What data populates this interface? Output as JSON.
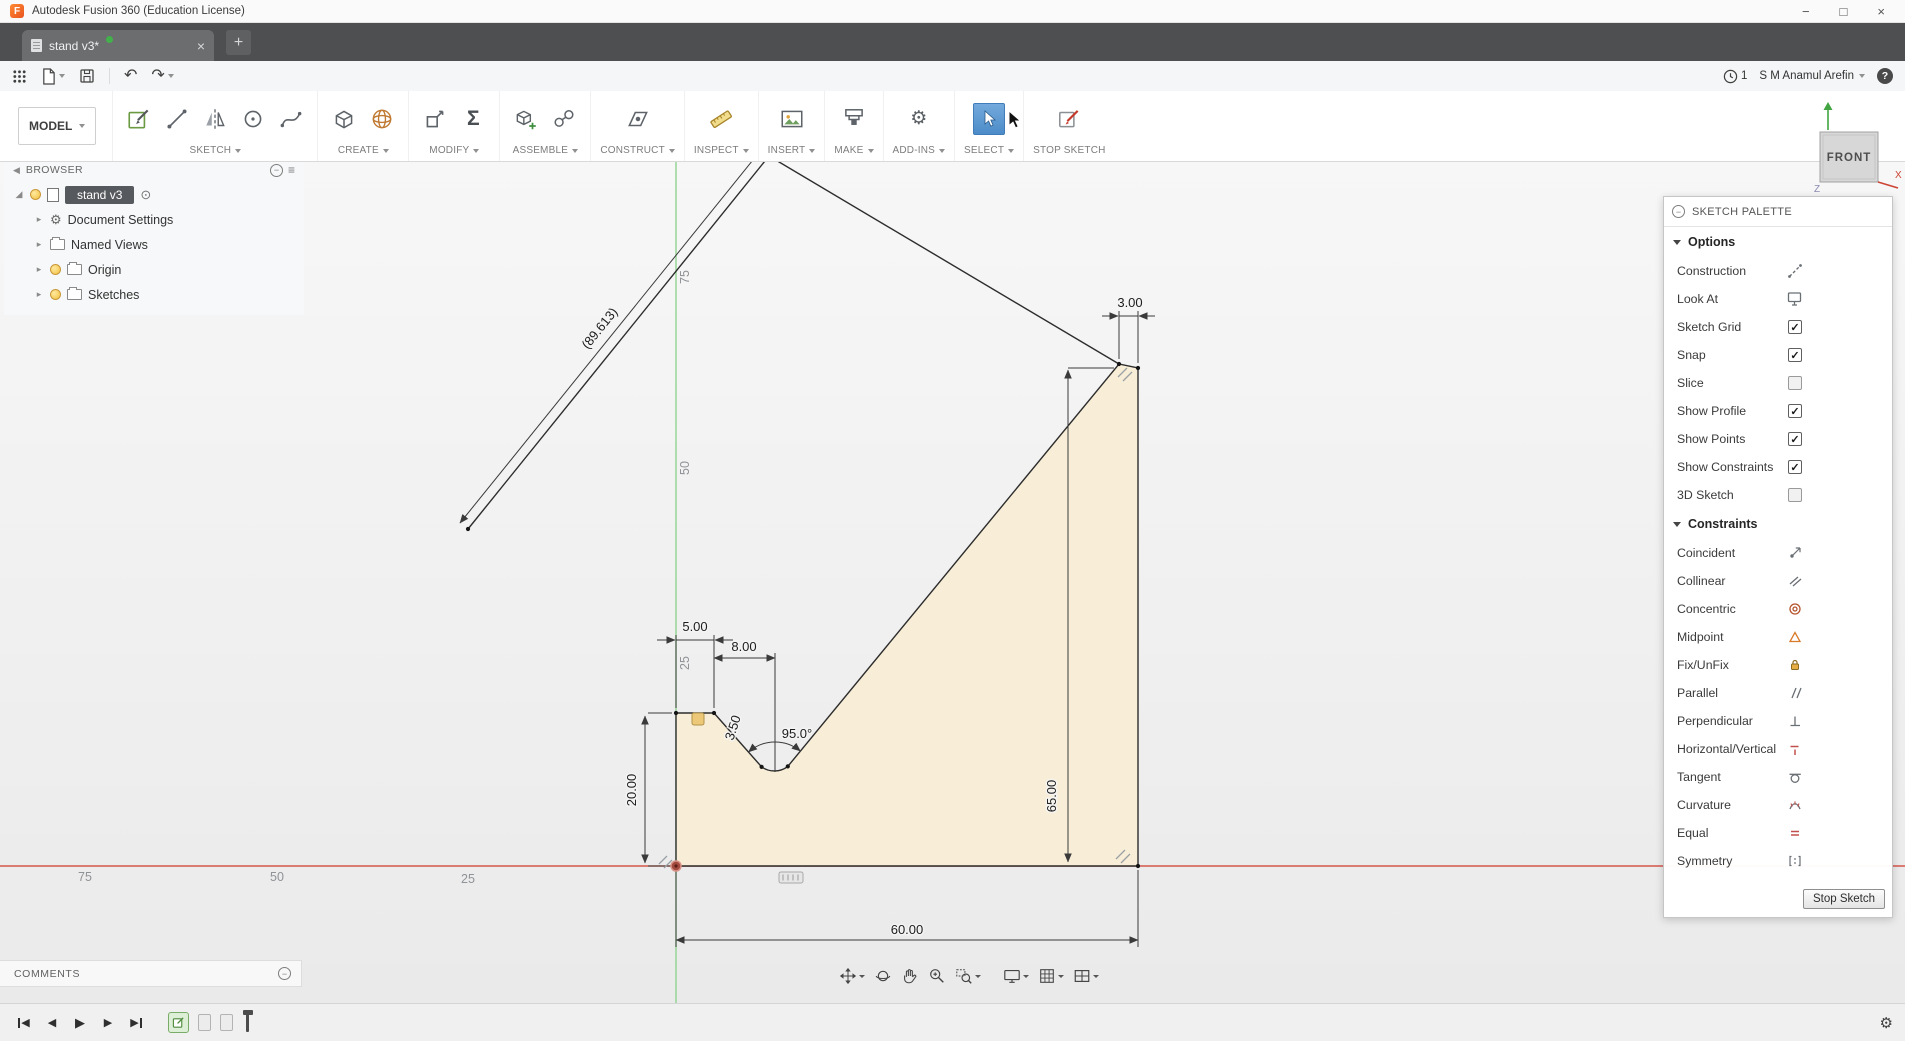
{
  "titlebar": {
    "title": "Autodesk Fusion 360 (Education License)",
    "minimize": "−",
    "maximize": "□",
    "close": "×"
  },
  "tabbar": {
    "active_tab": "stand v3*",
    "close_icon": "×",
    "new_tab": "+"
  },
  "qat": {
    "badge_count": "1",
    "user_name": "S M Anamul Arefin",
    "help_label": "?"
  },
  "ribbon": {
    "workspace": "MODEL",
    "groups": [
      {
        "label": "SKETCH",
        "icons": [
          "create-sketch",
          "line",
          "mirror",
          "circle",
          "spline"
        ]
      },
      {
        "label": "CREATE",
        "icons": [
          "box",
          "form"
        ]
      },
      {
        "label": "MODIFY",
        "icons": [
          "press-pull",
          "parameters-sigma"
        ]
      },
      {
        "label": "ASSEMBLE",
        "icons": [
          "new-component",
          "joint"
        ]
      },
      {
        "label": "CONSTRUCT",
        "icons": [
          "construction-plane"
        ]
      },
      {
        "label": "INSPECT",
        "icons": [
          "measure"
        ]
      },
      {
        "label": "INSERT",
        "icons": [
          "insert-image"
        ]
      },
      {
        "label": "MAKE",
        "icons": [
          "3d-print"
        ]
      },
      {
        "label": "ADD-INS",
        "icons": [
          "scripts-add-ins"
        ]
      },
      {
        "label": "SELECT",
        "icons": [
          "select-cursor"
        ]
      },
      {
        "label": "STOP SKETCH",
        "icons": [
          "stop-sketch"
        ]
      }
    ]
  },
  "browser": {
    "title": "BROWSER",
    "root_label": "stand v3",
    "items": [
      {
        "label": "Document Settings",
        "icon": "gear"
      },
      {
        "label": "Named Views",
        "icon": "folder"
      },
      {
        "label": "Origin",
        "icon": "folder-bulb"
      },
      {
        "label": "Sketches",
        "icon": "folder-bulb"
      }
    ]
  },
  "viewcube": {
    "face": "FRONT",
    "axis_x": "X",
    "axis_z": "Z"
  },
  "canvas": {
    "dim_bottom_width": "60.00",
    "dim_right_height": "65.00",
    "dim_left_height": "20.00",
    "dim_step_width": "5.00",
    "dim_notch_width": "8.00",
    "dim_notch_radius": "3.50",
    "dim_notch_angle": "95.0°",
    "dim_top_notch": "3.00",
    "dim_diagonal_ref": "(89.613)",
    "ruler_y": [
      "75",
      "50",
      "25"
    ],
    "ruler_x": [
      "75",
      "50",
      "25"
    ]
  },
  "palette": {
    "title": "SKETCH PALETTE",
    "options_header": "Options",
    "options": [
      {
        "label": "Construction",
        "control": "icon",
        "icon": "construction-icon"
      },
      {
        "label": "Look At",
        "control": "icon",
        "icon": "look-at-icon"
      },
      {
        "label": "Sketch Grid",
        "control": "checkbox",
        "checked": true
      },
      {
        "label": "Snap",
        "control": "checkbox",
        "checked": true
      },
      {
        "label": "Slice",
        "control": "checkbox",
        "checked": false
      },
      {
        "label": "Show Profile",
        "control": "checkbox",
        "checked": true
      },
      {
        "label": "Show Points",
        "control": "checkbox",
        "checked": true
      },
      {
        "label": "Show Constraints",
        "control": "checkbox",
        "checked": true
      },
      {
        "label": "3D Sketch",
        "control": "checkbox",
        "checked": false
      }
    ],
    "constraints_header": "Constraints",
    "constraints": [
      {
        "label": "Coincident"
      },
      {
        "label": "Collinear"
      },
      {
        "label": "Concentric"
      },
      {
        "label": "Midpoint"
      },
      {
        "label": "Fix/UnFix"
      },
      {
        "label": "Parallel"
      },
      {
        "label": "Perpendicular"
      },
      {
        "label": "Horizontal/Vertical"
      },
      {
        "label": "Tangent"
      },
      {
        "label": "Curvature"
      },
      {
        "label": "Equal"
      },
      {
        "label": "Symmetry"
      }
    ],
    "stop_button": "Stop Sketch"
  },
  "comments": {
    "title": "COMMENTS"
  },
  "navbar": {
    "icons": [
      "pan",
      "orbit",
      "pan-hand",
      "zoom-in",
      "zoom-window",
      "display-settings",
      "grid-and-snaps",
      "viewports"
    ]
  },
  "timeline": {
    "controls": [
      "skip-to-start",
      "step-back",
      "play",
      "step-forward",
      "skip-to-end"
    ]
  },
  "colors": {
    "accent_select": "#4a90d9",
    "axis_x": "#d4564a",
    "axis_y": "#8fd48f",
    "profile_fill": "#f8eed7"
  }
}
